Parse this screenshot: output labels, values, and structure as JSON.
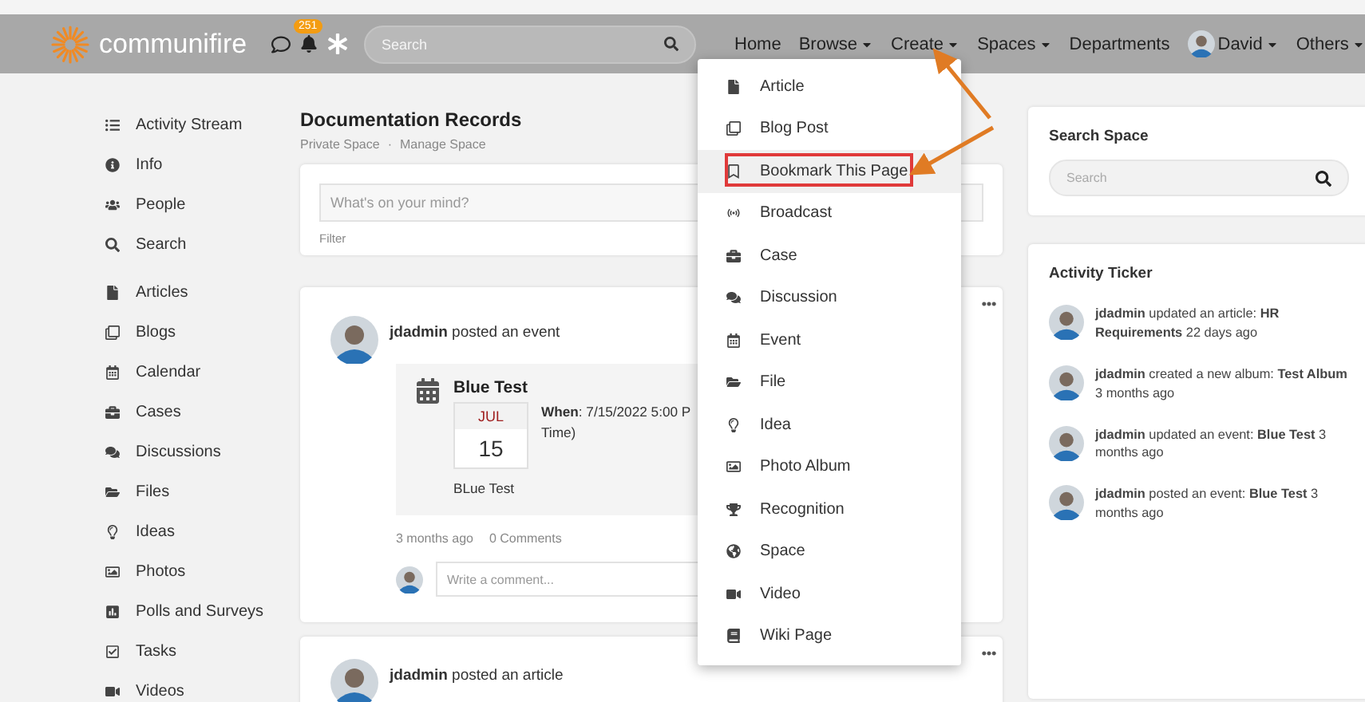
{
  "header": {
    "logo": "communifire",
    "notifications_badge": "251",
    "search": {
      "placeholder": "Search"
    },
    "nav": [
      {
        "label": "Home",
        "has_menu": false,
        "avatar": false
      },
      {
        "label": "Browse",
        "has_menu": true,
        "avatar": false
      },
      {
        "label": "Create",
        "has_menu": true,
        "avatar": false
      },
      {
        "label": "Spaces",
        "has_menu": true,
        "avatar": false
      },
      {
        "label": "Departments",
        "has_menu": false,
        "avatar": false
      },
      {
        "label": "David",
        "has_menu": true,
        "avatar": true
      },
      {
        "label": "Others",
        "has_menu": true,
        "avatar": false
      }
    ]
  },
  "sidebar": {
    "groups": [
      [
        "Activity Stream",
        "Info",
        "People",
        "Search"
      ],
      [
        "Articles",
        "Blogs",
        "Calendar",
        "Cases",
        "Discussions",
        "Files",
        "Ideas",
        "Photos",
        "Polls and Surveys",
        "Tasks",
        "Videos"
      ]
    ]
  },
  "space": {
    "title": "Documentation Records",
    "breadcrumb": [
      "Private Space",
      "Manage Space"
    ],
    "breadcrumb_separator": "·"
  },
  "composer": {
    "placeholder": "What's on your mind?",
    "filter": "Filter"
  },
  "posts": [
    {
      "headline": "**jdadmin** posted an event",
      "event": {
        "title": "Blue Test",
        "month": "JUL",
        "day": "15",
        "when": "**When**: 7/15/2022 5:00 P",
        "when_tail": "Time)",
        "caption": "BLue Test"
      },
      "time": "3 months ago",
      "comments": "0 Comments",
      "comment_placeholder": "Write a comment..."
    },
    {
      "headline": "**jdadmin** posted an article"
    }
  ],
  "search_space": {
    "title": "Search Space",
    "placeholder": "Search"
  },
  "activity_ticker": {
    "title": "Activity Ticker",
    "items": [
      "**jdadmin** updated an article: **HR Requirements** 22 days ago",
      "**jdadmin** created a new album: **Test Album** 3 months ago",
      "**jdadmin** updated an event: **Blue Test** 3 months ago",
      "**jdadmin** posted an event: **Blue Test** 3 months ago"
    ]
  },
  "create_menu": {
    "items": [
      {
        "label": "Article",
        "selected": false
      },
      {
        "label": "Blog Post",
        "selected": false
      },
      {
        "label": "Bookmark This Page",
        "selected": true
      },
      {
        "label": "Broadcast",
        "selected": false
      },
      {
        "label": "Case",
        "selected": false
      },
      {
        "label": "Discussion",
        "selected": false
      },
      {
        "label": "Event",
        "selected": false
      },
      {
        "label": "File",
        "selected": false
      },
      {
        "label": "Idea",
        "selected": false
      },
      {
        "label": "Photo Album",
        "selected": false
      },
      {
        "label": "Recognition",
        "selected": false
      },
      {
        "label": "Space",
        "selected": false
      },
      {
        "label": "Video",
        "selected": false
      },
      {
        "label": "Wiki Page",
        "selected": false
      }
    ]
  }
}
